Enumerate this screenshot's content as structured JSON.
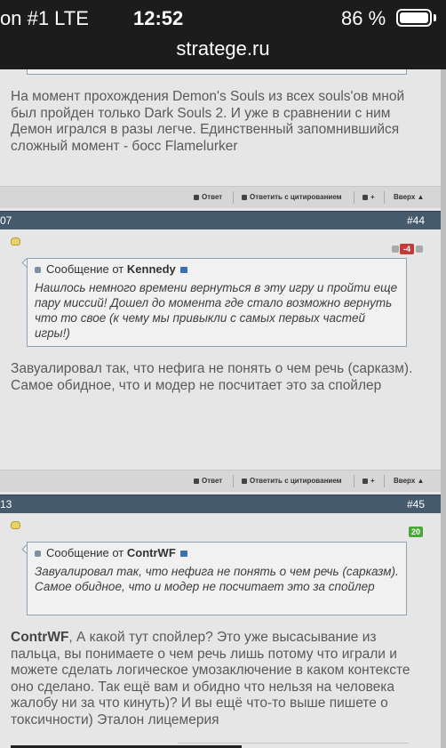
{
  "status_bar": {
    "carrier": "on #1  LTE",
    "time": "12:52",
    "battery": "86 %",
    "url": "stratege.ru"
  },
  "post_top": {
    "text": "На момент прохождения Demon's Souls из всех souls'ов мной был пройден только Dark Souls 2. И уже в сравнении с ним Демон игрался в разы легче. Единственный запомнившийся сложный момент - босс Flamelurker"
  },
  "actions": {
    "reply": "Ответ",
    "quote": "Ответить с цитированием",
    "top": "Вверх"
  },
  "post_44": {
    "header_left": "07",
    "number": "#44",
    "reputation": "-4",
    "quote_prefix": "Сообщение от",
    "quote_author": "Kennedy",
    "quote_text": "Нашлось немного времени вернуться в эту игру и пройти еще пару миссий! Дошел до момента где стало возможно вернуть что то свое (к чему мы привыкли с самых первых частей игры!)",
    "text": "Завуалировал так, что нефига не понять о чем речь (сарказм). Самое обидное, что и модер не посчитает это за спойлер"
  },
  "post_45": {
    "header_left": "13",
    "number": "#45",
    "reputation": "20",
    "quote_prefix": "Сообщение от",
    "quote_author": "ContrWF",
    "quote_text": "Завуалировал так, что нефига не понять о чем речь (сарказм). Самое обидное, что и модер не посчитает это за спойлер",
    "reply_to": "ContrWF",
    "text": ", А какой тут спойлер? Это уже высасывание из пальца, вы понимаете о чем речь лишь потому что играли и можете сделать логическое умозаключение в каком контексте оно сделано. Так ещё вам и обидно что нельзя на человека жалобу ни за что кинуть)? И вы ещё что-то выше пишете о токсичности) Эталон лицемерия"
  }
}
